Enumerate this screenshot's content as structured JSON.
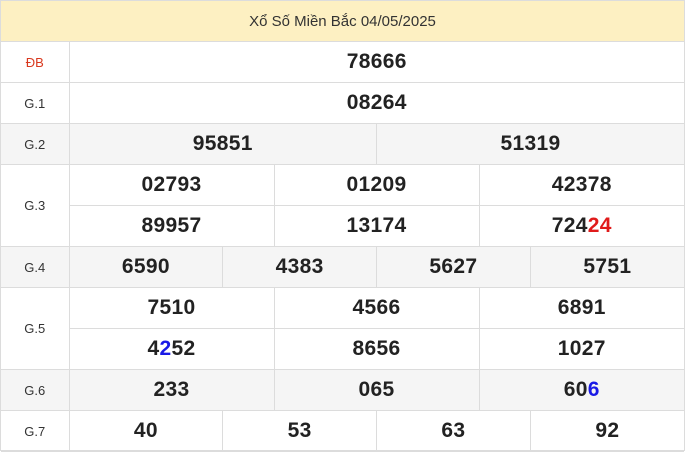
{
  "header": {
    "title": "Xổ Số Miền Bắc 04/05/2025"
  },
  "prizes": {
    "db": {
      "label": "ĐB",
      "values": [
        "78666"
      ]
    },
    "g1": {
      "label": "G.1",
      "values": [
        "08264"
      ]
    },
    "g2": {
      "label": "G.2",
      "values": [
        "95851",
        "51319"
      ]
    },
    "g3": {
      "label": "G.3",
      "values": [
        "02793",
        "01209",
        "42378",
        "89957",
        "13174",
        "72424"
      ]
    },
    "g4": {
      "label": "G.4",
      "values": [
        "6590",
        "4383",
        "5627",
        "5751"
      ]
    },
    "g5": {
      "label": "G.5",
      "values": [
        "7510",
        "4566",
        "6891",
        "4252",
        "8656",
        "1027"
      ]
    },
    "g6": {
      "label": "G.6",
      "values": [
        "233",
        "065",
        "606"
      ]
    },
    "g7": {
      "label": "G.7",
      "values": [
        "40",
        "53",
        "63",
        "92"
      ]
    }
  },
  "highlights": {
    "g3_5_prefix": "724",
    "g3_5_suffix": "24",
    "g5_3_pre": "4",
    "g5_3_mid": "2",
    "g5_3_post": "52",
    "g6_2_prefix": "60",
    "g6_2_suffix": "6"
  },
  "colors": {
    "header_bg": "#fdf0c2",
    "alt_row": "#f5f5f5",
    "special_label": "#d9381e",
    "highlight_red": "#e01b1b",
    "highlight_blue": "#1a1ae6"
  }
}
